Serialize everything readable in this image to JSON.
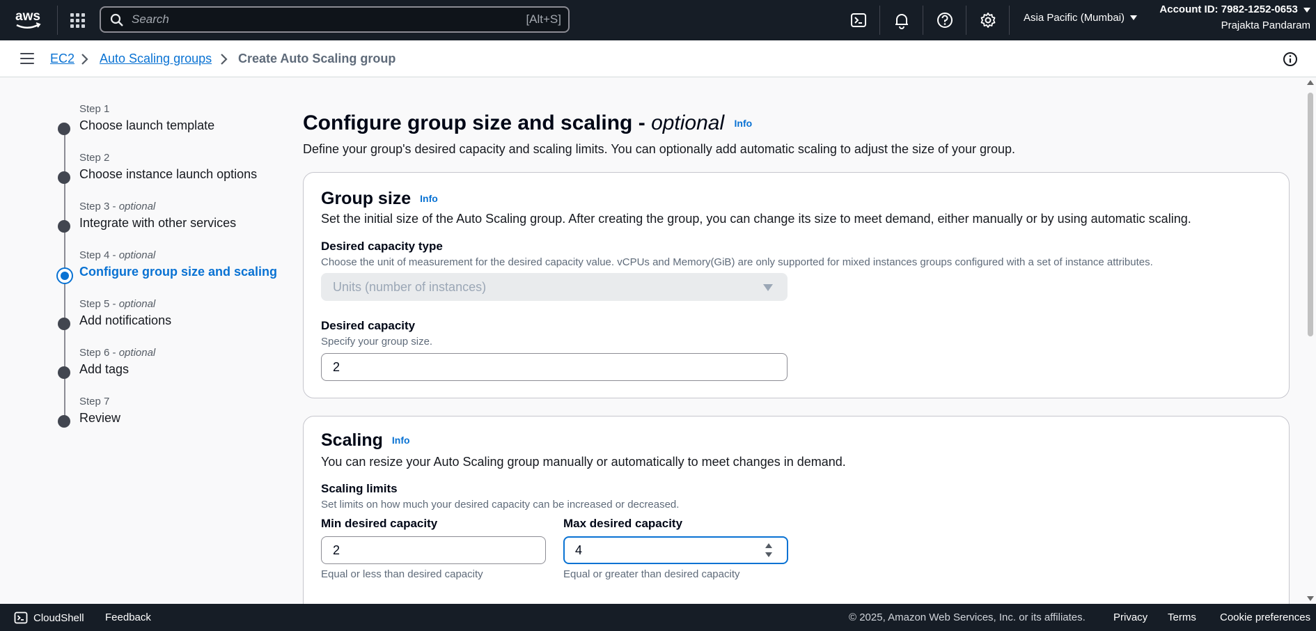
{
  "topnav": {
    "logo": "aws",
    "search_placeholder": "Search",
    "search_shortcut": "[Alt+S]",
    "icons": [
      "cloudshell-icon",
      "bell-icon",
      "help-icon",
      "gear-icon"
    ],
    "region": "Asia Pacific (Mumbai)",
    "account_id": "Account ID: 7982-1252-0653",
    "user": "Prajakta Pandaram"
  },
  "breadcrumb": {
    "items": [
      "EC2",
      "Auto Scaling groups",
      "Create Auto Scaling group"
    ]
  },
  "steps": [
    {
      "label": "Step 1",
      "optional": "",
      "title": "Choose launch template"
    },
    {
      "label": "Step 2",
      "optional": "",
      "title": "Choose instance launch options"
    },
    {
      "label": "Step 3",
      "optional": "optional",
      "title": "Integrate with other services"
    },
    {
      "label": "Step 4",
      "optional": "optional",
      "title": "Configure group size and scaling"
    },
    {
      "label": "Step 5",
      "optional": "optional",
      "title": "Add notifications"
    },
    {
      "label": "Step 6",
      "optional": "optional",
      "title": "Add tags"
    },
    {
      "label": "Step 7",
      "optional": "",
      "title": "Review"
    }
  ],
  "active_step": 4,
  "page": {
    "title": "Configure group size and scaling",
    "title_suffix": "optional",
    "info": "Info",
    "description": "Define your group's desired capacity and scaling limits. You can optionally add automatic scaling to adjust the size of your group."
  },
  "group_size": {
    "heading": "Group size",
    "info": "Info",
    "description": "Set the initial size of the Auto Scaling group. After creating the group, you can change its size to meet demand, either manually or by using automatic scaling.",
    "capacity_type_label": "Desired capacity type",
    "capacity_type_desc": "Choose the unit of measurement for the desired capacity value. vCPUs and Memory(GiB) are only supported for mixed instances groups configured with a set of instance attributes.",
    "capacity_type_value": "Units (number of instances)",
    "desired_capacity_label": "Desired capacity",
    "desired_capacity_desc": "Specify your group size.",
    "desired_capacity_value": "2"
  },
  "scaling": {
    "heading": "Scaling",
    "info": "Info",
    "description": "You can resize your Auto Scaling group manually or automatically to meet changes in demand.",
    "limits_label": "Scaling limits",
    "limits_desc": "Set limits on how much your desired capacity can be increased or decreased.",
    "min_label": "Min desired capacity",
    "min_value": "2",
    "min_help": "Equal or less than desired capacity",
    "max_label": "Max desired capacity",
    "max_value": "4",
    "max_help": "Equal or greater than desired capacity"
  },
  "footer": {
    "cloudshell": "CloudShell",
    "feedback": "Feedback",
    "copyright": "© 2025, Amazon Web Services, Inc. or its affiliates.",
    "privacy": "Privacy",
    "terms": "Terms",
    "cookie": "Cookie preferences"
  },
  "colors": {
    "nav_bg": "#161d26",
    "link": "#0972d3",
    "page_bg": "#f9f9fa"
  }
}
